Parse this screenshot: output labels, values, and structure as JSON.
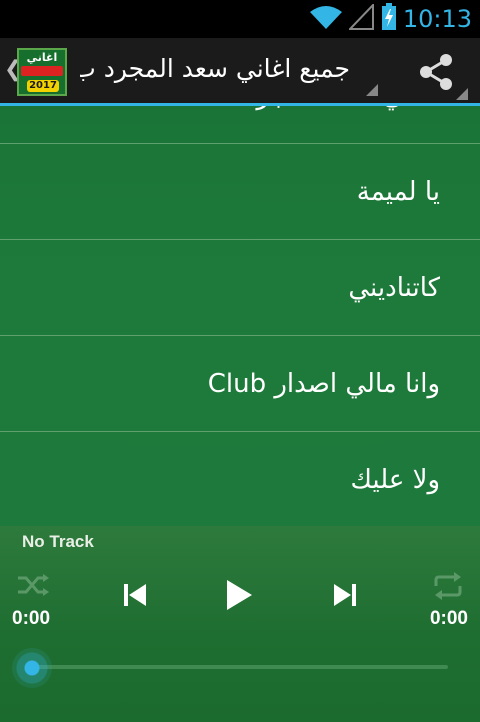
{
  "status_bar": {
    "time": "10:13",
    "icons": [
      "wifi-icon",
      "signal-icon",
      "battery-charging-icon"
    ]
  },
  "action_bar": {
    "title": "جميع اغاني سعد المجرد ب",
    "logo": {
      "top_text": "اغاني",
      "year": "2017"
    },
    "icons": [
      "up-caret-icon",
      "share-icon"
    ]
  },
  "songs": [
    "ولا عليك",
    "وانا مالي اصدار Club",
    "كاتناديني",
    "يا لميمة",
    "اغاني سعد المجرد"
  ],
  "player": {
    "track_title": "No Track",
    "time_elapsed": "0:00",
    "time_total": "0:00",
    "progress": 0,
    "controls": [
      "shuffle-icon",
      "previous-icon",
      "play-icon",
      "next-icon",
      "repeat-icon"
    ]
  },
  "colors": {
    "accent": "#33b5e5",
    "list_background": "#1e7a3c",
    "action_bar": "#1b1b1b"
  }
}
